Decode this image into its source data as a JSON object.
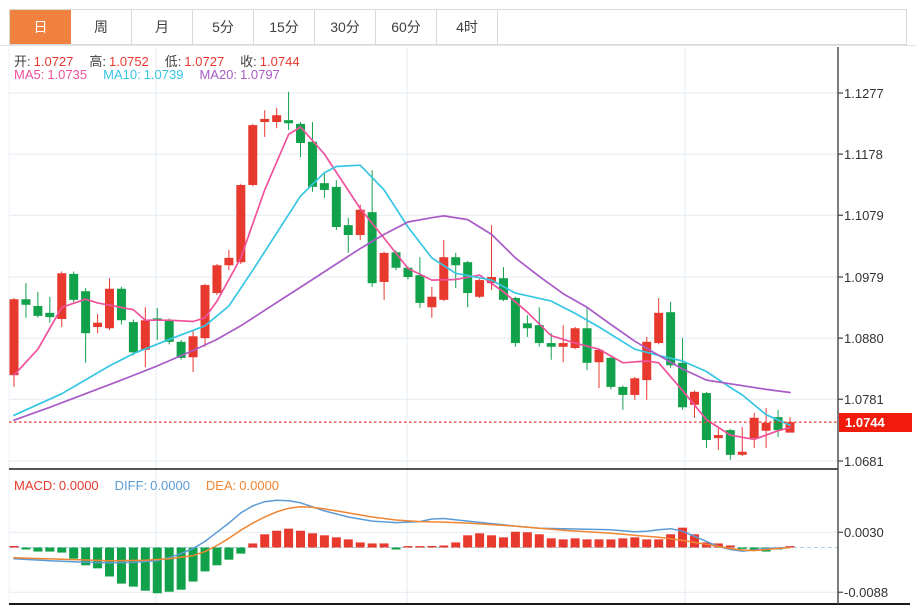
{
  "toolbar": {
    "tabs": [
      {
        "label": "日",
        "name": "day",
        "active": true
      },
      {
        "label": "周",
        "name": "week",
        "active": false
      },
      {
        "label": "月",
        "name": "month",
        "active": false
      },
      {
        "label": "5分",
        "name": "5min",
        "active": false
      },
      {
        "label": "15分",
        "name": "15min",
        "active": false
      },
      {
        "label": "30分",
        "name": "30min",
        "active": false
      },
      {
        "label": "60分",
        "name": "60min",
        "active": false
      },
      {
        "label": "4时",
        "name": "4hour",
        "active": false
      }
    ]
  },
  "legend": {
    "open_label": "开:",
    "open_value": "1.0727",
    "high_label": "高:",
    "high_value": "1.0752",
    "low_label": "低:",
    "low_value": "1.0727",
    "close_label": "收:",
    "close_value": "1.0744",
    "ma5_label": "MA5:",
    "ma5_value": "1.0735",
    "ma10_label": "MA10:",
    "ma10_value": "1.0739",
    "ma20_label": "MA20:",
    "ma20_value": "1.0797"
  },
  "macd_legend": {
    "macd_label": "MACD:",
    "macd_value": "0.0000",
    "diff_label": "DIFF:",
    "diff_value": "0.0000",
    "dea_label": "DEA:",
    "dea_value": "0.0000"
  },
  "colors": {
    "up": "#e8392f",
    "down": "#12a14b",
    "ma5": "#f0519c",
    "ma10": "#36c6e3",
    "ma20": "#a95bc7",
    "diff": "#5b9bd5",
    "dea": "#f08532",
    "tab_active": "#f0813f",
    "grid": "#e4ebf2",
    "axis": "#444444",
    "label": "#3f3f3f",
    "price_tag": "#f11b0c",
    "dotted": "#f2342c",
    "zero_dash": "#a5d5e8",
    "pane_border": "#1a1a1a"
  },
  "chart_data": {
    "type": "candlestick",
    "title": "",
    "convention": "chinese (red = up, green = down)",
    "price_axis": {
      "tick_labels": [
        "1.1277",
        "1.1178",
        "1.1079",
        "1.0979",
        "1.0880",
        "1.0781",
        "1.0681"
      ],
      "tick_values": [
        1.1277,
        1.1178,
        1.1079,
        1.0979,
        1.088,
        1.0781,
        1.0681
      ],
      "last_price": 1.0744,
      "last_price_label": "1.0744"
    },
    "candles": [
      [
        1.082,
        1.0945,
        1.0801,
        1.0943
      ],
      [
        1.0943,
        1.0969,
        1.0913,
        1.0934
      ],
      [
        1.0932,
        1.0955,
        1.0913,
        1.0916
      ],
      [
        1.0921,
        1.0947,
        1.0905,
        1.0914
      ],
      [
        1.0911,
        1.0988,
        1.0898,
        1.0985
      ],
      [
        1.0984,
        1.0988,
        1.0938,
        1.0942
      ],
      [
        1.0956,
        1.0961,
        1.084,
        1.0888
      ],
      [
        1.0898,
        1.0919,
        1.0888,
        1.0905
      ],
      [
        1.0896,
        1.0977,
        1.0893,
        1.096
      ],
      [
        1.096,
        1.0963,
        1.0902,
        1.0909
      ],
      [
        1.0906,
        1.091,
        1.0852,
        1.0857
      ],
      [
        1.0861,
        1.093,
        1.0833,
        1.0909
      ],
      [
        1.0912,
        1.0929,
        1.0877,
        1.0908
      ],
      [
        1.0909,
        1.0912,
        1.087,
        1.0874
      ],
      [
        1.0874,
        1.0877,
        1.0845,
        1.0848
      ],
      [
        1.0849,
        1.0893,
        1.0825,
        1.0883
      ],
      [
        1.088,
        1.0968,
        1.0866,
        1.0966
      ],
      [
        1.0953,
        1.1,
        1.095,
        1.0998
      ],
      [
        1.0998,
        1.1023,
        1.099,
        1.101
      ],
      [
        1.1003,
        1.113,
        1.1,
        1.1128
      ],
      [
        1.1128,
        1.1227,
        1.1126,
        1.1225
      ],
      [
        1.123,
        1.1249,
        1.1206,
        1.1235
      ],
      [
        1.123,
        1.1253,
        1.122,
        1.1241
      ],
      [
        1.1233,
        1.1279,
        1.1217,
        1.1228
      ],
      [
        1.1227,
        1.123,
        1.1173,
        1.1196
      ],
      [
        1.1198,
        1.123,
        1.1117,
        1.1125
      ],
      [
        1.1131,
        1.1149,
        1.1107,
        1.112
      ],
      [
        1.1125,
        1.1136,
        1.1055,
        1.106
      ],
      [
        1.1063,
        1.1075,
        1.1018,
        1.1047
      ],
      [
        1.1047,
        1.1096,
        1.1039,
        1.1088
      ],
      [
        1.1084,
        1.1152,
        1.0963,
        1.0969
      ],
      [
        1.0971,
        1.102,
        1.0942,
        1.1018
      ],
      [
        1.1019,
        1.1022,
        1.099,
        1.0994
      ],
      [
        1.0994,
        1.0996,
        1.0975,
        1.0979
      ],
      [
        1.0982,
        1.1011,
        1.0929,
        1.0937
      ],
      [
        1.093,
        1.0963,
        1.0913,
        1.0947
      ],
      [
        1.0942,
        1.1039,
        1.094,
        1.1011
      ],
      [
        1.1011,
        1.1018,
        1.0961,
        1.0998
      ],
      [
        1.1003,
        1.1005,
        1.093,
        1.0953
      ],
      [
        1.0947,
        1.0976,
        1.0945,
        1.0974
      ],
      [
        1.0969,
        1.1063,
        1.0958,
        1.0979
      ],
      [
        1.0977,
        1.0995,
        1.094,
        1.0942
      ],
      [
        1.0945,
        1.0947,
        1.0866,
        1.0872
      ],
      [
        1.0904,
        1.0917,
        1.0882,
        1.0896
      ],
      [
        1.0901,
        1.093,
        1.0866,
        1.0872
      ],
      [
        1.0872,
        1.0888,
        1.0845,
        1.0866
      ],
      [
        1.0866,
        1.0901,
        1.0841,
        1.0872
      ],
      [
        1.0864,
        1.0898,
        1.0862,
        1.0896
      ],
      [
        1.0896,
        1.0929,
        1.0828,
        1.084
      ],
      [
        1.0841,
        1.0863,
        1.0799,
        1.0861
      ],
      [
        1.0848,
        1.085,
        1.0797,
        1.0801
      ],
      [
        1.0801,
        1.0803,
        1.0764,
        1.0788
      ],
      [
        1.0788,
        1.0817,
        1.078,
        1.0815
      ],
      [
        1.0812,
        1.0882,
        1.078,
        1.0874
      ],
      [
        1.0872,
        1.0945,
        1.087,
        1.0921
      ],
      [
        1.0922,
        1.0939,
        1.0832,
        1.0836
      ],
      [
        1.084,
        1.088,
        1.0764,
        1.0768
      ],
      [
        1.0772,
        1.0795,
        1.0751,
        1.0793
      ],
      [
        1.0791,
        1.0793,
        1.0702,
        1.0715
      ],
      [
        1.0718,
        1.0736,
        1.0699,
        1.0723
      ],
      [
        1.0731,
        1.0733,
        1.0683,
        1.0691
      ],
      [
        1.0691,
        1.0736,
        1.0689,
        1.0696
      ],
      [
        1.0718,
        1.0759,
        1.0702,
        1.0751
      ],
      [
        1.073,
        1.0767,
        1.0702,
        1.0743
      ],
      [
        1.0752,
        1.0764,
        1.072,
        1.0731
      ],
      [
        1.0727,
        1.0752,
        1.0727,
        1.0744
      ]
    ],
    "ma5_points": [
      [
        0,
        1.082
      ],
      [
        2,
        1.0862
      ],
      [
        4,
        1.093
      ],
      [
        6,
        1.0943
      ],
      [
        7,
        1.0937
      ],
      [
        10,
        1.0926
      ],
      [
        11,
        1.0909
      ],
      [
        13,
        1.0909
      ],
      [
        15,
        1.0907
      ],
      [
        16,
        1.0913
      ],
      [
        17,
        1.094
      ],
      [
        19,
        1.101
      ],
      [
        21,
        1.112
      ],
      [
        23,
        1.121
      ],
      [
        24,
        1.1222
      ],
      [
        26,
        1.1178
      ],
      [
        29,
        1.109
      ],
      [
        31,
        1.1042
      ],
      [
        33,
        1.0993
      ],
      [
        35,
        1.0974
      ],
      [
        37,
        1.0975
      ],
      [
        39,
        1.0982
      ],
      [
        41,
        1.0955
      ],
      [
        43,
        1.0922
      ],
      [
        45,
        1.0884
      ],
      [
        47,
        1.0872
      ],
      [
        49,
        1.0862
      ],
      [
        51,
        1.084
      ],
      [
        53,
        1.0843
      ],
      [
        54,
        1.084
      ],
      [
        56,
        1.0795
      ],
      [
        58,
        1.0748
      ],
      [
        60,
        1.0723
      ],
      [
        62,
        1.0716
      ],
      [
        64,
        1.073
      ],
      [
        65,
        1.0735
      ]
    ],
    "ma10_points": [
      [
        0,
        1.0755
      ],
      [
        4,
        1.079
      ],
      [
        8,
        1.0835
      ],
      [
        10,
        1.0855
      ],
      [
        13,
        1.0878
      ],
      [
        16,
        1.09
      ],
      [
        18,
        1.0932
      ],
      [
        20,
        1.099
      ],
      [
        22,
        1.105
      ],
      [
        24,
        1.111
      ],
      [
        26,
        1.1148
      ],
      [
        27,
        1.1158
      ],
      [
        29,
        1.116
      ],
      [
        31,
        1.112
      ],
      [
        33,
        1.106
      ],
      [
        35,
        1.101
      ],
      [
        37,
        1.0985
      ],
      [
        40,
        1.0974
      ],
      [
        42,
        1.0953
      ],
      [
        45,
        1.094
      ],
      [
        47,
        1.092
      ],
      [
        49,
        1.0898
      ],
      [
        52,
        1.0862
      ],
      [
        54,
        1.0852
      ],
      [
        56,
        1.0843
      ],
      [
        58,
        1.0826
      ],
      [
        60,
        1.08
      ],
      [
        61,
        1.0788
      ],
      [
        63,
        1.0756
      ],
      [
        65,
        1.0739
      ]
    ],
    "ma20_points": [
      [
        0,
        1.0747
      ],
      [
        3,
        1.0768
      ],
      [
        6,
        1.079
      ],
      [
        9,
        1.0812
      ],
      [
        12,
        1.0835
      ],
      [
        15,
        1.086
      ],
      [
        17,
        1.0878
      ],
      [
        19,
        1.09
      ],
      [
        21,
        1.0925
      ],
      [
        23,
        1.095
      ],
      [
        25,
        1.0975
      ],
      [
        27,
        1.1
      ],
      [
        29,
        1.1025
      ],
      [
        31,
        1.1048
      ],
      [
        33,
        1.1068
      ],
      [
        35,
        1.1075
      ],
      [
        36,
        1.1078
      ],
      [
        38,
        1.1072
      ],
      [
        40,
        1.1048
      ],
      [
        42,
        1.101
      ],
      [
        44,
        1.098
      ],
      [
        46,
        1.0952
      ],
      [
        48,
        1.093
      ],
      [
        50,
        1.0902
      ],
      [
        52,
        1.0875
      ],
      [
        54,
        1.0852
      ],
      [
        56,
        1.083
      ],
      [
        58,
        1.0812
      ],
      [
        60,
        1.0806
      ],
      [
        63,
        1.0797
      ],
      [
        65,
        1.0792
      ]
    ],
    "macd": {
      "axis_labels": [
        "0.0030",
        "-0.0088"
      ],
      "axis_values": [
        0.003,
        -0.0088
      ],
      "histogram": [
        0.0003,
        -0.0004,
        -0.0008,
        -0.0008,
        -0.001,
        -0.0022,
        -0.0035,
        -0.0041,
        -0.0057,
        -0.0071,
        -0.0077,
        -0.0085,
        -0.009,
        -0.0087,
        -0.0083,
        -0.0067,
        -0.0047,
        -0.0035,
        -0.0024,
        -0.0012,
        0.0008,
        0.0026,
        0.0033,
        0.0037,
        0.0033,
        0.0028,
        0.0024,
        0.002,
        0.0016,
        0.001,
        0.0008,
        0.0008,
        -0.0004,
        0.0002,
        0.0002,
        0.0003,
        0.0004,
        0.001,
        0.0024,
        0.0028,
        0.0024,
        0.002,
        0.0031,
        0.003,
        0.0026,
        0.0018,
        0.0016,
        0.0018,
        0.0016,
        0.0016,
        0.0016,
        0.0018,
        0.002,
        0.0016,
        0.0016,
        0.0026,
        0.0039,
        0.0026,
        0.001,
        0.0008,
        0.0004,
        -0.0002,
        -0.0004,
        -0.0008,
        -0.0004,
        0.0
      ],
      "diff_points": [
        [
          0,
          -0.0022
        ],
        [
          3,
          -0.0026
        ],
        [
          6,
          -0.0029
        ],
        [
          8,
          -0.003
        ],
        [
          10,
          -0.0029
        ],
        [
          12,
          -0.0026
        ],
        [
          13,
          -0.002
        ],
        [
          14,
          -0.0012
        ],
        [
          15,
          -0.0002
        ],
        [
          16,
          0.0012
        ],
        [
          17,
          0.003
        ],
        [
          18,
          0.0048
        ],
        [
          19,
          0.0068
        ],
        [
          20,
          0.0082
        ],
        [
          21,
          0.009
        ],
        [
          22,
          0.0093
        ],
        [
          23,
          0.0092
        ],
        [
          24,
          0.0088
        ],
        [
          25,
          0.008
        ],
        [
          26,
          0.0072
        ],
        [
          28,
          0.006
        ],
        [
          30,
          0.0052
        ],
        [
          32,
          0.0049
        ],
        [
          34,
          0.0051
        ],
        [
          35,
          0.0056
        ],
        [
          36,
          0.0057
        ],
        [
          38,
          0.0052
        ],
        [
          40,
          0.0047
        ],
        [
          42,
          0.0042
        ],
        [
          44,
          0.0038
        ],
        [
          46,
          0.0037
        ],
        [
          48,
          0.0036
        ],
        [
          50,
          0.0035
        ],
        [
          52,
          0.0031
        ],
        [
          53,
          0.0032
        ],
        [
          54,
          0.0035
        ],
        [
          55,
          0.0037
        ],
        [
          56,
          0.0032
        ],
        [
          57,
          0.0022
        ],
        [
          58,
          0.0012
        ],
        [
          59,
          0.0002
        ],
        [
          60,
          -0.0004
        ],
        [
          61,
          -0.0007
        ],
        [
          62,
          -0.0005
        ],
        [
          63,
          -0.0002
        ],
        [
          64,
          -0.0001
        ],
        [
          65,
          0.0
        ]
      ],
      "dea_points": [
        [
          0,
          -0.002
        ],
        [
          4,
          -0.0023
        ],
        [
          8,
          -0.0026
        ],
        [
          11,
          -0.0025
        ],
        [
          13,
          -0.0022
        ],
        [
          15,
          -0.0016
        ],
        [
          16,
          -0.0008
        ],
        [
          17,
          0.0004
        ],
        [
          18,
          0.0018
        ],
        [
          19,
          0.0034
        ],
        [
          20,
          0.0048
        ],
        [
          21,
          0.006
        ],
        [
          22,
          0.007
        ],
        [
          23,
          0.0077
        ],
        [
          24,
          0.008
        ],
        [
          25,
          0.0079
        ],
        [
          26,
          0.0076
        ],
        [
          28,
          0.0068
        ],
        [
          30,
          0.006
        ],
        [
          32,
          0.0054
        ],
        [
          34,
          0.0051
        ],
        [
          36,
          0.005
        ],
        [
          38,
          0.0048
        ],
        [
          40,
          0.0045
        ],
        [
          42,
          0.0042
        ],
        [
          44,
          0.0038
        ],
        [
          46,
          0.0034
        ],
        [
          48,
          0.0031
        ],
        [
          50,
          0.0028
        ],
        [
          52,
          0.0024
        ],
        [
          54,
          0.002
        ],
        [
          56,
          0.0014
        ],
        [
          57,
          0.001
        ],
        [
          58,
          0.0006
        ],
        [
          59,
          0.0002
        ],
        [
          60,
          -0.0002
        ],
        [
          61,
          -0.0005
        ],
        [
          62,
          -0.0006
        ],
        [
          63,
          -0.0004
        ],
        [
          64,
          -0.0002
        ],
        [
          65,
          0.0
        ]
      ]
    },
    "layout": {
      "grid": true,
      "vertical_gridlines_x": [
        156,
        407,
        685
      ],
      "legend_position": "top-left overlay"
    }
  }
}
